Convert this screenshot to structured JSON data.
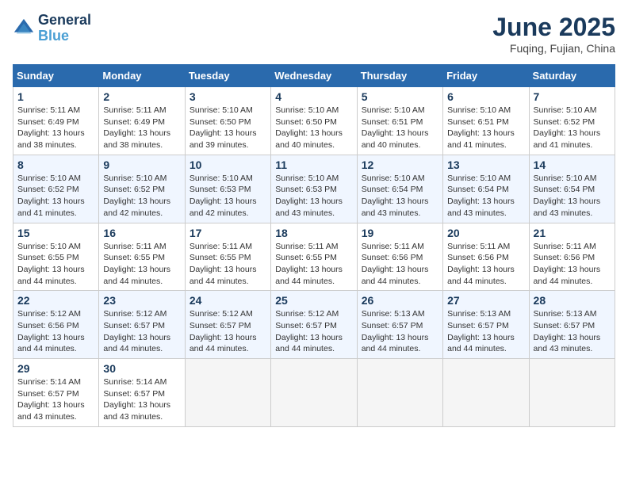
{
  "header": {
    "logo_line1": "General",
    "logo_line2": "Blue",
    "month_title": "June 2025",
    "location": "Fuqing, Fujian, China"
  },
  "weekdays": [
    "Sunday",
    "Monday",
    "Tuesday",
    "Wednesday",
    "Thursday",
    "Friday",
    "Saturday"
  ],
  "days": [
    {
      "num": "",
      "info": ""
    },
    {
      "num": "",
      "info": ""
    },
    {
      "num": "",
      "info": ""
    },
    {
      "num": "",
      "info": ""
    },
    {
      "num": "",
      "info": ""
    },
    {
      "num": "",
      "info": ""
    },
    {
      "num": "7",
      "info": "Sunrise: 5:10 AM\nSunset: 6:52 PM\nDaylight: 13 hours\nand 41 minutes."
    },
    {
      "num": "1",
      "info": "Sunrise: 5:11 AM\nSunset: 6:49 PM\nDaylight: 13 hours\nand 38 minutes."
    },
    {
      "num": "2",
      "info": "Sunrise: 5:11 AM\nSunset: 6:49 PM\nDaylight: 13 hours\nand 38 minutes."
    },
    {
      "num": "3",
      "info": "Sunrise: 5:10 AM\nSunset: 6:50 PM\nDaylight: 13 hours\nand 39 minutes."
    },
    {
      "num": "4",
      "info": "Sunrise: 5:10 AM\nSunset: 6:50 PM\nDaylight: 13 hours\nand 40 minutes."
    },
    {
      "num": "5",
      "info": "Sunrise: 5:10 AM\nSunset: 6:51 PM\nDaylight: 13 hours\nand 40 minutes."
    },
    {
      "num": "6",
      "info": "Sunrise: 5:10 AM\nSunset: 6:51 PM\nDaylight: 13 hours\nand 41 minutes."
    },
    {
      "num": "7",
      "info": "Sunrise: 5:10 AM\nSunset: 6:52 PM\nDaylight: 13 hours\nand 41 minutes."
    },
    {
      "num": "8",
      "info": "Sunrise: 5:10 AM\nSunset: 6:52 PM\nDaylight: 13 hours\nand 41 minutes."
    },
    {
      "num": "9",
      "info": "Sunrise: 5:10 AM\nSunset: 6:52 PM\nDaylight: 13 hours\nand 42 minutes."
    },
    {
      "num": "10",
      "info": "Sunrise: 5:10 AM\nSunset: 6:53 PM\nDaylight: 13 hours\nand 42 minutes."
    },
    {
      "num": "11",
      "info": "Sunrise: 5:10 AM\nSunset: 6:53 PM\nDaylight: 13 hours\nand 43 minutes."
    },
    {
      "num": "12",
      "info": "Sunrise: 5:10 AM\nSunset: 6:54 PM\nDaylight: 13 hours\nand 43 minutes."
    },
    {
      "num": "13",
      "info": "Sunrise: 5:10 AM\nSunset: 6:54 PM\nDaylight: 13 hours\nand 43 minutes."
    },
    {
      "num": "14",
      "info": "Sunrise: 5:10 AM\nSunset: 6:54 PM\nDaylight: 13 hours\nand 43 minutes."
    },
    {
      "num": "15",
      "info": "Sunrise: 5:10 AM\nSunset: 6:55 PM\nDaylight: 13 hours\nand 44 minutes."
    },
    {
      "num": "16",
      "info": "Sunrise: 5:11 AM\nSunset: 6:55 PM\nDaylight: 13 hours\nand 44 minutes."
    },
    {
      "num": "17",
      "info": "Sunrise: 5:11 AM\nSunset: 6:55 PM\nDaylight: 13 hours\nand 44 minutes."
    },
    {
      "num": "18",
      "info": "Sunrise: 5:11 AM\nSunset: 6:55 PM\nDaylight: 13 hours\nand 44 minutes."
    },
    {
      "num": "19",
      "info": "Sunrise: 5:11 AM\nSunset: 6:56 PM\nDaylight: 13 hours\nand 44 minutes."
    },
    {
      "num": "20",
      "info": "Sunrise: 5:11 AM\nSunset: 6:56 PM\nDaylight: 13 hours\nand 44 minutes."
    },
    {
      "num": "21",
      "info": "Sunrise: 5:11 AM\nSunset: 6:56 PM\nDaylight: 13 hours\nand 44 minutes."
    },
    {
      "num": "22",
      "info": "Sunrise: 5:12 AM\nSunset: 6:56 PM\nDaylight: 13 hours\nand 44 minutes."
    },
    {
      "num": "23",
      "info": "Sunrise: 5:12 AM\nSunset: 6:57 PM\nDaylight: 13 hours\nand 44 minutes."
    },
    {
      "num": "24",
      "info": "Sunrise: 5:12 AM\nSunset: 6:57 PM\nDaylight: 13 hours\nand 44 minutes."
    },
    {
      "num": "25",
      "info": "Sunrise: 5:12 AM\nSunset: 6:57 PM\nDaylight: 13 hours\nand 44 minutes."
    },
    {
      "num": "26",
      "info": "Sunrise: 5:13 AM\nSunset: 6:57 PM\nDaylight: 13 hours\nand 44 minutes."
    },
    {
      "num": "27",
      "info": "Sunrise: 5:13 AM\nSunset: 6:57 PM\nDaylight: 13 hours\nand 44 minutes."
    },
    {
      "num": "28",
      "info": "Sunrise: 5:13 AM\nSunset: 6:57 PM\nDaylight: 13 hours\nand 43 minutes."
    },
    {
      "num": "29",
      "info": "Sunrise: 5:14 AM\nSunset: 6:57 PM\nDaylight: 13 hours\nand 43 minutes."
    },
    {
      "num": "30",
      "info": "Sunrise: 5:14 AM\nSunset: 6:57 PM\nDaylight: 13 hours\nand 43 minutes."
    },
    {
      "num": "",
      "info": ""
    },
    {
      "num": "",
      "info": ""
    },
    {
      "num": "",
      "info": ""
    },
    {
      "num": "",
      "info": ""
    },
    {
      "num": "",
      "info": ""
    }
  ]
}
